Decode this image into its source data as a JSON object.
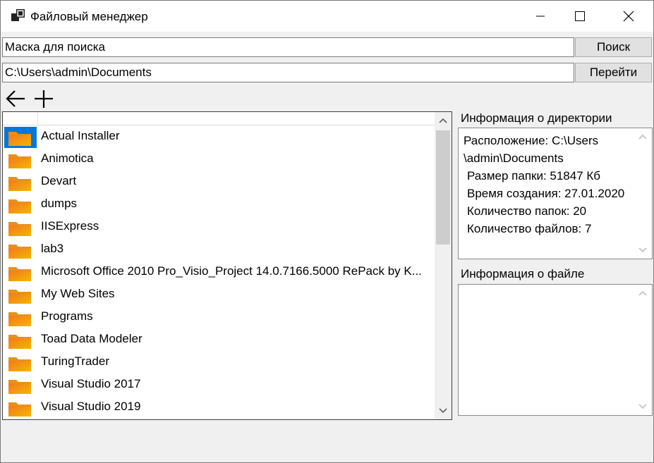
{
  "window": {
    "title": "Файловый менеджер"
  },
  "search": {
    "value": "Маска для поиска",
    "button": "Поиск"
  },
  "path": {
    "value": "C:\\Users\\admin\\Documents",
    "button": "Перейти"
  },
  "toolbar": {
    "back_icon": "arrow-left-icon",
    "add_icon": "plus-icon"
  },
  "list": {
    "items": [
      {
        "label": "Actual Installer",
        "selected": true
      },
      {
        "label": "Animotica"
      },
      {
        "label": "Devart"
      },
      {
        "label": "dumps"
      },
      {
        "label": "IISExpress"
      },
      {
        "label": "lab3"
      },
      {
        "label": "Microsoft Office 2010 Pro_Visio_Project 14.0.7166.5000 RePack by K..."
      },
      {
        "label": "My Web Sites"
      },
      {
        "label": "Programs"
      },
      {
        "label": "Toad Data Modeler"
      },
      {
        "label": "TuringTrader"
      },
      {
        "label": "Visual Studio 2017"
      },
      {
        "label": "Visual Studio 2019"
      }
    ]
  },
  "dir_info": {
    "title": "Информация о директории",
    "location_line1": "Расположение: C:\\Users",
    "location_line2": "\\admin\\Documents",
    "size": "Размер папки: 51847 Кб",
    "created": "Время создания: 27.01.2020",
    "folders": "Количество папок: 20",
    "files": "Количество файлов: 7"
  },
  "file_info": {
    "title": "Информация о файле",
    "content": ""
  },
  "colors": {
    "selection": "#0078d7",
    "folder_top": "#f7b500",
    "folder_bottom": "#f07a20"
  }
}
